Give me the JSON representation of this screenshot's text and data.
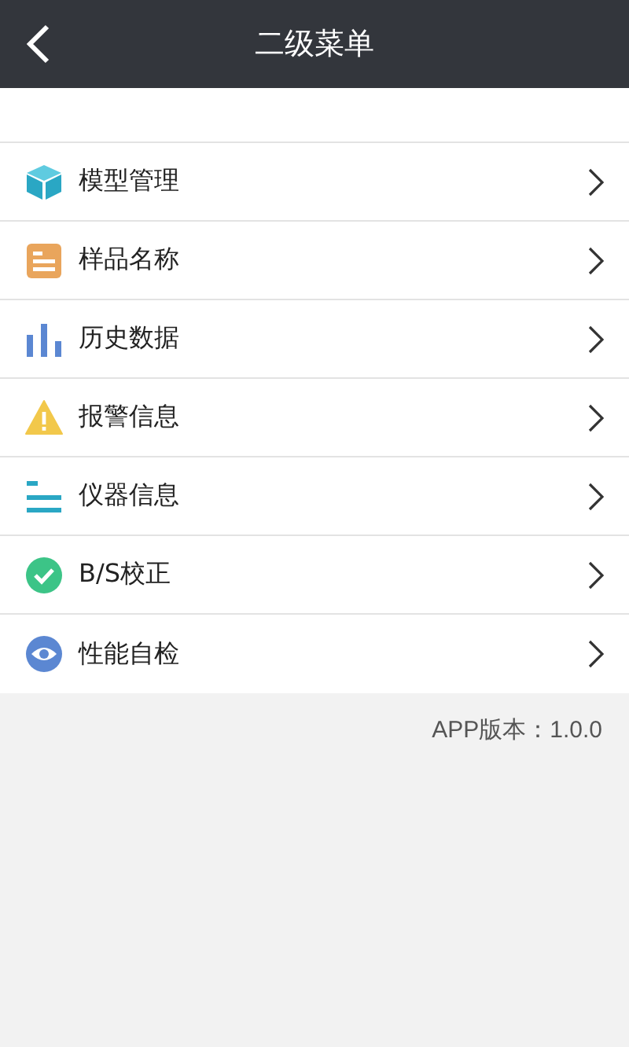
{
  "header": {
    "title": "二级菜单"
  },
  "menu": [
    {
      "label": "模型管理",
      "kind": "cube"
    },
    {
      "label": "样品名称",
      "kind": "list"
    },
    {
      "label": "历史数据",
      "kind": "bars"
    },
    {
      "label": "报警信息",
      "kind": "warning"
    },
    {
      "label": "仪器信息",
      "kind": "lines"
    },
    {
      "label": "B/S校正",
      "kind": "check"
    },
    {
      "label": "性能自检",
      "kind": "eye"
    }
  ],
  "version": "APP版本：1.0.0"
}
